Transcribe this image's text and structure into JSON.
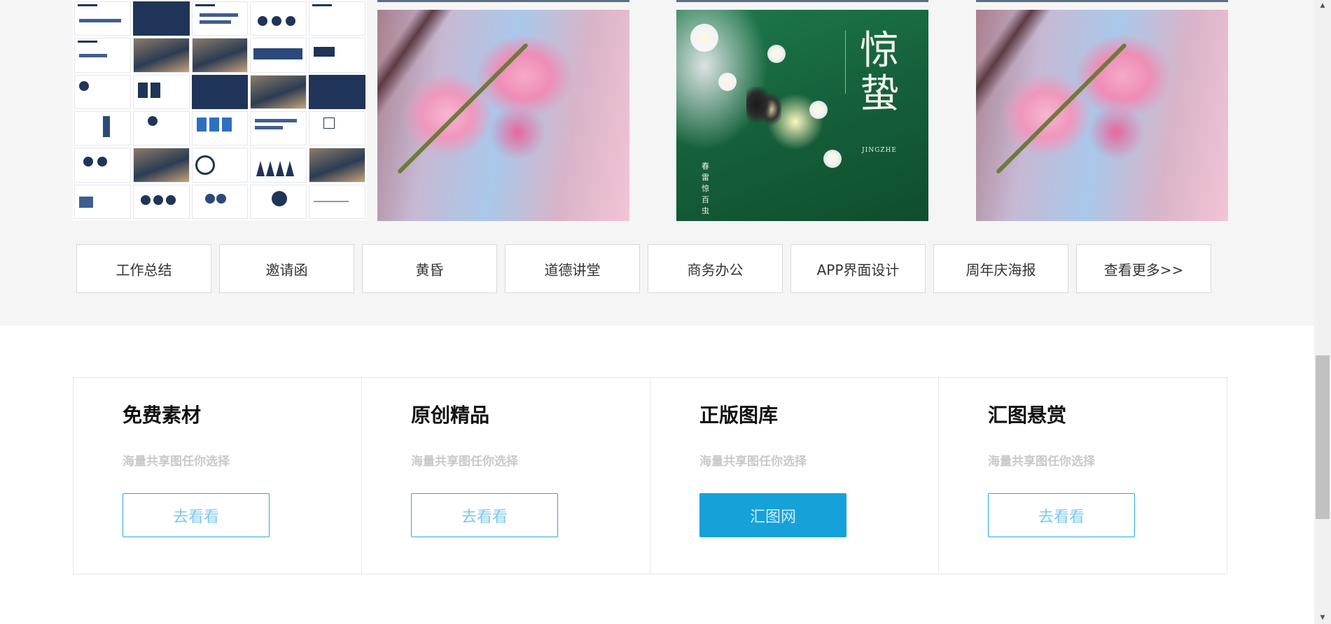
{
  "gallery": {
    "thumbnails": [
      {
        "name": "ppt-template-thumbnail",
        "title": ""
      },
      {
        "name": "peach-blossom-image",
        "title": ""
      },
      {
        "name": "jingzhe-poster-image",
        "title": "惊蛰",
        "subtitle": "JINGZHE",
        "vertical_text": "春雷惊百虫"
      },
      {
        "name": "peach-blossom-image-2",
        "title": ""
      }
    ]
  },
  "tags": [
    "工作总结",
    "邀请函",
    "黄昏",
    "道德讲堂",
    "商务办公",
    "APP界面设计",
    "周年庆海报",
    "查看更多>>"
  ],
  "cards": [
    {
      "title": "免费素材",
      "subtitle": "海量共享图任你选择",
      "button": "去看看",
      "primary": false
    },
    {
      "title": "原创精品",
      "subtitle": "海量共享图任你选择",
      "button": "去看看",
      "primary": false
    },
    {
      "title": "正版图库",
      "subtitle": "海量共享图任你选择",
      "button": "汇图网",
      "primary": true
    },
    {
      "title": "汇图悬赏",
      "subtitle": "海量共享图任你选择",
      "button": "去看看",
      "primary": false
    }
  ],
  "colors": {
    "accent": "#16a1d9",
    "section_bg": "#f5f5f5",
    "muted_text": "#c9c9c9"
  },
  "scrollbar": {
    "up_icon": "chevron-up-icon",
    "down_icon": "chevron-down-icon"
  }
}
